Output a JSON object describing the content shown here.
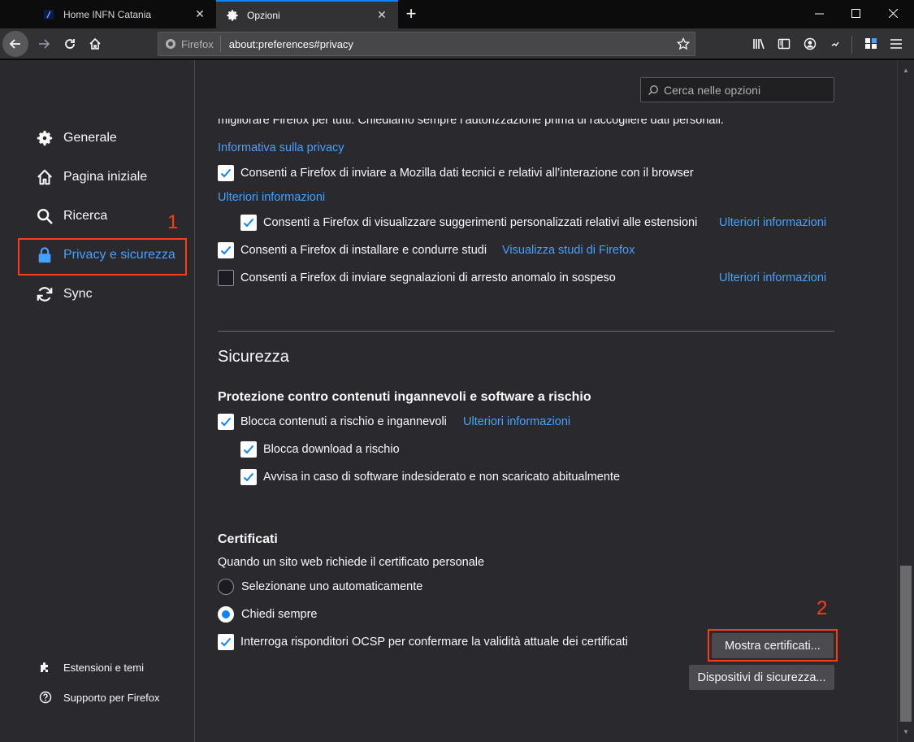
{
  "tabs": [
    {
      "title": "Home INFN Catania",
      "active": false
    },
    {
      "title": "Opzioni",
      "active": true
    }
  ],
  "navbar": {
    "identity_label": "Firefox",
    "url": "about:preferences#privacy"
  },
  "search": {
    "placeholder": "Cerca nelle opzioni"
  },
  "sidebar": {
    "categories": [
      {
        "label": "Generale",
        "icon": "gear-icon"
      },
      {
        "label": "Pagina iniziale",
        "icon": "home-icon"
      },
      {
        "label": "Ricerca",
        "icon": "search-icon"
      },
      {
        "label": "Privacy e sicurezza",
        "icon": "lock-icon",
        "selected": true
      },
      {
        "label": "Sync",
        "icon": "sync-icon"
      }
    ],
    "footer": [
      {
        "label": "Estensioni e temi",
        "icon": "puzzle-icon"
      },
      {
        "label": "Supporto per Firefox",
        "icon": "help-icon"
      }
    ]
  },
  "annotations": {
    "one": "1",
    "two": "2"
  },
  "data_collection": {
    "cut_text": "migliorare Firefox per tutti. Chiediamo sempre l’autorizzazione prima di raccogliere dati personali.",
    "privacy_link": "Informativa sulla privacy",
    "telemetry": {
      "label": "Consenti a Firefox di inviare a Mozilla dati tecnici e relativi all’interazione con il browser",
      "checked": true
    },
    "telemetry_more": "Ulteriori informazioni",
    "recommend": {
      "label": "Consenti a Firefox di visualizzare suggerimenti personalizzati relativi alle estensioni",
      "checked": true,
      "link": "Ulteriori informazioni"
    },
    "studies": {
      "label": "Consenti a Firefox di installare e condurre studi",
      "checked": true,
      "link": "Visualizza studi di Firefox"
    },
    "crash": {
      "label": "Consenti a Firefox di inviare segnalazioni di arresto anomalo in sospeso",
      "checked": false,
      "link": "Ulteriori informazioni"
    }
  },
  "security": {
    "heading": "Sicurezza",
    "protection_heading": "Protezione contro contenuti ingannevoli e software a rischio",
    "block_dangerous": {
      "label": "Blocca contenuti a rischio e ingannevoli",
      "checked": true,
      "link": "Ulteriori informazioni"
    },
    "block_downloads": {
      "label": "Blocca download a rischio",
      "checked": true
    },
    "warn_unwanted": {
      "label": "Avvisa in caso di software indesiderato e non scaricato abitualmente",
      "checked": true
    }
  },
  "certificates": {
    "heading": "Certificati",
    "description": "Quando un sito web richiede il certificato personale",
    "auto_select": {
      "label": "Selezionane uno automaticamente",
      "checked": false
    },
    "ask_every": {
      "label": "Chiedi sempre",
      "checked": true
    },
    "ocsp": {
      "label": "Interroga risponditori OCSP per confermare la validità attuale dei certificati",
      "checked": true
    },
    "view_button": "Mostra certificati...",
    "devices_button": "Dispositivi di sicurezza..."
  },
  "colors": {
    "accent": "#0a84ff",
    "link": "#45a1ff",
    "highlight": "#ff3b18",
    "background": "#2a2a2e"
  }
}
